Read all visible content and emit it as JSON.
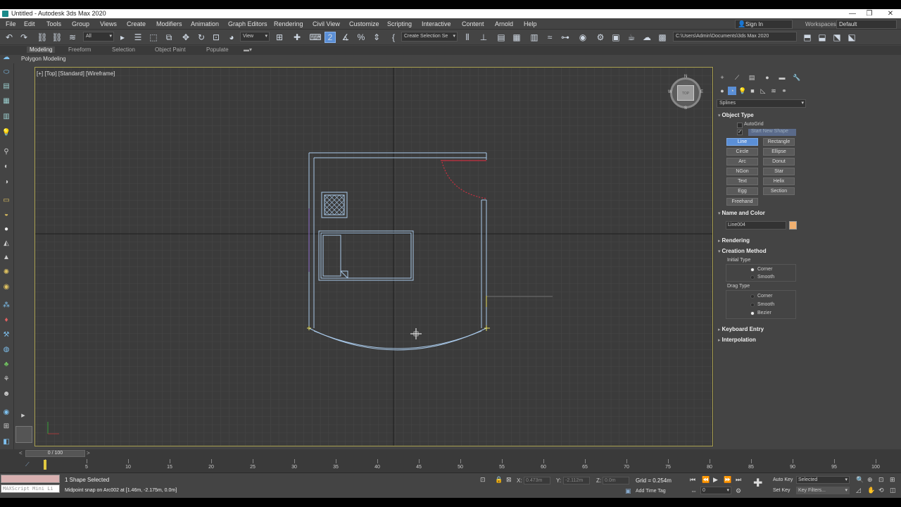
{
  "window": {
    "title": "Untitled - Autodesk 3ds Max 2020",
    "controls": [
      "—",
      "❐",
      "✕"
    ]
  },
  "menu": {
    "items": [
      "File",
      "Edit",
      "Tools",
      "Group",
      "Views",
      "Create",
      "Modifiers",
      "Animation",
      "Graph Editors",
      "Rendering",
      "Civil View",
      "Customize",
      "Scripting",
      "Interactive",
      "Content",
      "Arnold",
      "Help"
    ],
    "sign_in": "Sign In",
    "workspaces_label": "Workspaces:",
    "workspace_value": "Default"
  },
  "toolbar": {
    "selection_filter": "All",
    "ref_coord": "View",
    "named_selection": "Create Selection Se",
    "project_path": "C:\\Users\\Admin\\Documents\\3ds Max 2020"
  },
  "ribbon": {
    "tabs": [
      "Modeling",
      "Freeform",
      "Selection",
      "Object Paint",
      "Populate"
    ],
    "active_tab": "Modeling",
    "sub_label": "Polygon Modeling"
  },
  "viewport": {
    "label": "[+] [Top] [Standard] [Wireframe]",
    "viewcube_face": "TOP",
    "compass": {
      "n": "N",
      "s": "S",
      "e": "E",
      "w": "W"
    }
  },
  "command_panel": {
    "category": "Splines",
    "object_type": {
      "title": "Object Type",
      "autogrid": "AutoGrid",
      "start_new_shape": "Start New Shape",
      "start_new_shape_checked": true,
      "buttons": [
        "Line",
        "Rectangle",
        "Circle",
        "Ellipse",
        "Arc",
        "Donut",
        "NGon",
        "Star",
        "Text",
        "Helix",
        "Egg",
        "Section",
        "Freehand"
      ],
      "active_button": "Line"
    },
    "name_and_color": {
      "title": "Name and Color",
      "name": "Line004",
      "color": "#f0b070"
    },
    "rendering_title": "Rendering",
    "creation_method": {
      "title": "Creation Method",
      "initial_type_label": "Initial Type",
      "initial_options": [
        "Corner",
        "Smooth"
      ],
      "initial_selected": "Corner",
      "drag_type_label": "Drag Type",
      "drag_options": [
        "Corner",
        "Smooth",
        "Bezier"
      ],
      "drag_selected": "Bezier"
    },
    "keyboard_entry_title": "Keyboard Entry",
    "interpolation_title": "Interpolation"
  },
  "timeline": {
    "slider": "0 / 100",
    "ticks": [
      0,
      5,
      10,
      15,
      20,
      25,
      30,
      35,
      40,
      45,
      50,
      55,
      60,
      65,
      70,
      75,
      80,
      85,
      90,
      95,
      100
    ],
    "current_frame": 0
  },
  "status": {
    "maxscript_placeholder": "MAXScript Mini Li",
    "selection": "1 Shape Selected",
    "prompt": "Midpoint snap on Arc002 at [1.46m, -2.175m, 0.0m]",
    "x_label": "X:",
    "x_value": "0.473m",
    "y_label": "Y:",
    "y_value": "-2.112m",
    "z_label": "Z:",
    "z_value": "0.0m",
    "grid": "Grid = 0.254m",
    "add_time_tag": "Add Time Tag",
    "auto_key": "Auto Key",
    "set_key": "Set Key",
    "key_mode": "Selected",
    "key_filters": "Key Filters...",
    "frame_field": "0"
  }
}
